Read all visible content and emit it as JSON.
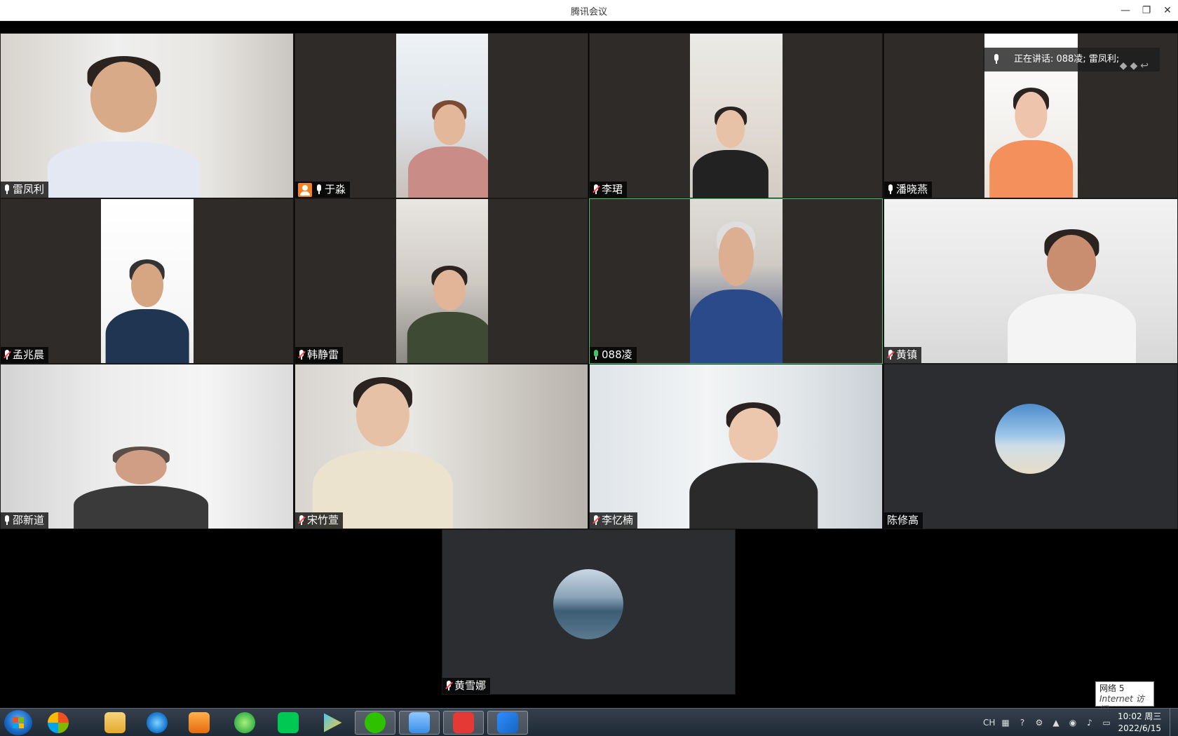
{
  "window": {
    "title": "腾讯会议",
    "min": "—",
    "max": "❐",
    "close": "✕"
  },
  "speaking": {
    "text": "正在讲话: 088凌; 雷凤利;"
  },
  "participants": [
    {
      "name": "雷凤利",
      "mic": "on"
    },
    {
      "name": "于淼",
      "mic": "on",
      "host": true
    },
    {
      "name": "李珺",
      "mic": "muted"
    },
    {
      "name": "潘晓燕",
      "mic": "on"
    },
    {
      "name": "孟兆晨",
      "mic": "muted"
    },
    {
      "name": "韩静雷",
      "mic": "muted"
    },
    {
      "name": "088凌",
      "mic": "speaking"
    },
    {
      "name": "黄镇",
      "mic": "muted"
    },
    {
      "name": "邵新道",
      "mic": "on"
    },
    {
      "name": "宋竹萱",
      "mic": "muted"
    },
    {
      "name": "李忆楠",
      "mic": "muted"
    },
    {
      "name": "陈修高",
      "mic": "none"
    },
    {
      "name": "黄雪娜",
      "mic": "muted"
    }
  ],
  "network_tip": {
    "line1": "网络  5",
    "line2": "Internet 访问"
  },
  "tray": {
    "lang": "CH"
  },
  "clock": {
    "time": "10:02 周三",
    "date": "2022/6/15"
  },
  "colors": {
    "speaking_border": "#3cc76a",
    "host_badge": "#f58220",
    "tile_bg": "#2f2b28"
  },
  "icons": [
    "start-icon",
    "pinwheel-icon",
    "folder-icon",
    "ie-icon",
    "media-player-icon",
    "browser-icon",
    "iqiyi-icon",
    "video-player-icon",
    "wechat-icon",
    "window-icon",
    "wps-icon",
    "tencent-meeting-icon"
  ]
}
